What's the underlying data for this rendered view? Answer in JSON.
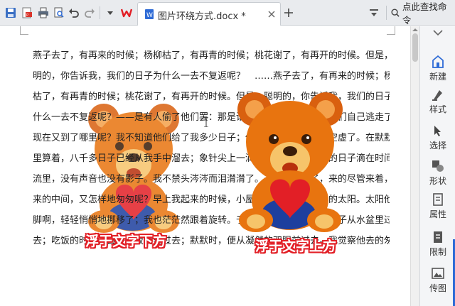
{
  "toolbar": {
    "tab_title": "图片环绕方式.docx *",
    "search_command": "点此查找命令",
    "icons": [
      "save-icon",
      "export-pdf-icon",
      "print-icon",
      "print-preview-icon",
      "undo-icon",
      "redo-icon",
      "more-dropdown-icon",
      "wps-logo-icon",
      "document-tab-icon",
      "close-tab-icon",
      "new-tab-icon",
      "dropdown-arrow-icon",
      "search-icon"
    ],
    "colors": {
      "wps_red": "#e21f26",
      "accent_blue": "#2e6bd6"
    }
  },
  "document": {
    "lines": [
      "燕子去了，有再来的时候；杨柳枯了，有再青的时候；桃花谢了，有再开的时候。但是，聪",
      "明的，你告诉我，我们的日子为什么一去不复返呢？　……燕子去了，有再来的时候；杨柳",
      "枯了，有再青的时候；桃花谢了，有再开的时候。但是，聪明的，你告诉我，我们的日子为",
      "什么一去不复返呢？——是有人偷了他们罢：那是谁？又藏在何处呢？是他们自己逃走了：",
      "现在又到了哪里呢？我不知道他们给了我多少日子；但我的手确乎是渐渐空虚了。在默默",
      "里算着，八千多日子已经从我手中溜去；象针尖上一滴水滴在大海里，我的日子滴在时间的",
      "流里，没有声音也没有影子。我不禁头涔涔而泪潸潸了。去的尽管去了，来的尽管来着，去",
      "来的中间，又怎样地匆匆呢？早上我起来的时候，小屋里射进两三方斜斜的太阳。太阳他有",
      "脚啊，轻轻悄悄地挪移了；我也茫茫然跟着旋转。于是——洗手的时候，日子从水盆里过",
      "去；吃饭的时候，日子从饭碗里过去；默默时，便从凝然的双眼前过去。我觉察他去的匆匆"
    ],
    "caption_below": "浮于文字下方",
    "caption_above": "浮于文字上方"
  },
  "side_panel": {
    "items": [
      {
        "label": "新建",
        "icon": "new-icon"
      },
      {
        "label": "样式",
        "icon": "style-icon"
      },
      {
        "label": "选择",
        "icon": "select-icon"
      },
      {
        "label": "形状",
        "icon": "shape-icon"
      },
      {
        "label": "属性",
        "icon": "properties-icon"
      },
      {
        "label": "限制",
        "icon": "restrict-icon"
      },
      {
        "label": "传图",
        "icon": "upload-image-icon"
      }
    ]
  }
}
